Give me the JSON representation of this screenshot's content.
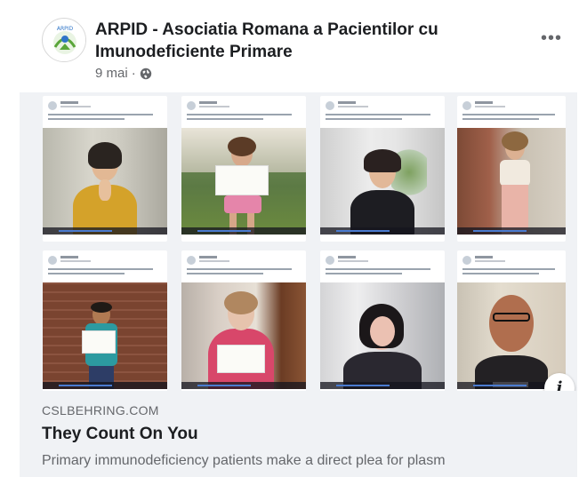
{
  "post": {
    "page_name": "ARPID - Asociatia Romana a Pacientilor cu Imunodeficiente Primare",
    "timestamp": "9 mai",
    "separator": "·",
    "audience_icon": "globe-icon",
    "more_icon": "more-options-icon",
    "more_glyph": "•••"
  },
  "link_preview": {
    "domain": "CSLBEHRING.COM",
    "title": "They Count On You",
    "description": "Primary immunodeficiency patients make a direct plea for plasm",
    "info_glyph": "i",
    "thumbnail_count": 8
  },
  "colors": {
    "title_text": "#1c1e21",
    "secondary_text": "#65676b",
    "preview_bg": "#f0f2f5",
    "logo_green": "#5aa63a",
    "logo_blue": "#2f75c8"
  }
}
